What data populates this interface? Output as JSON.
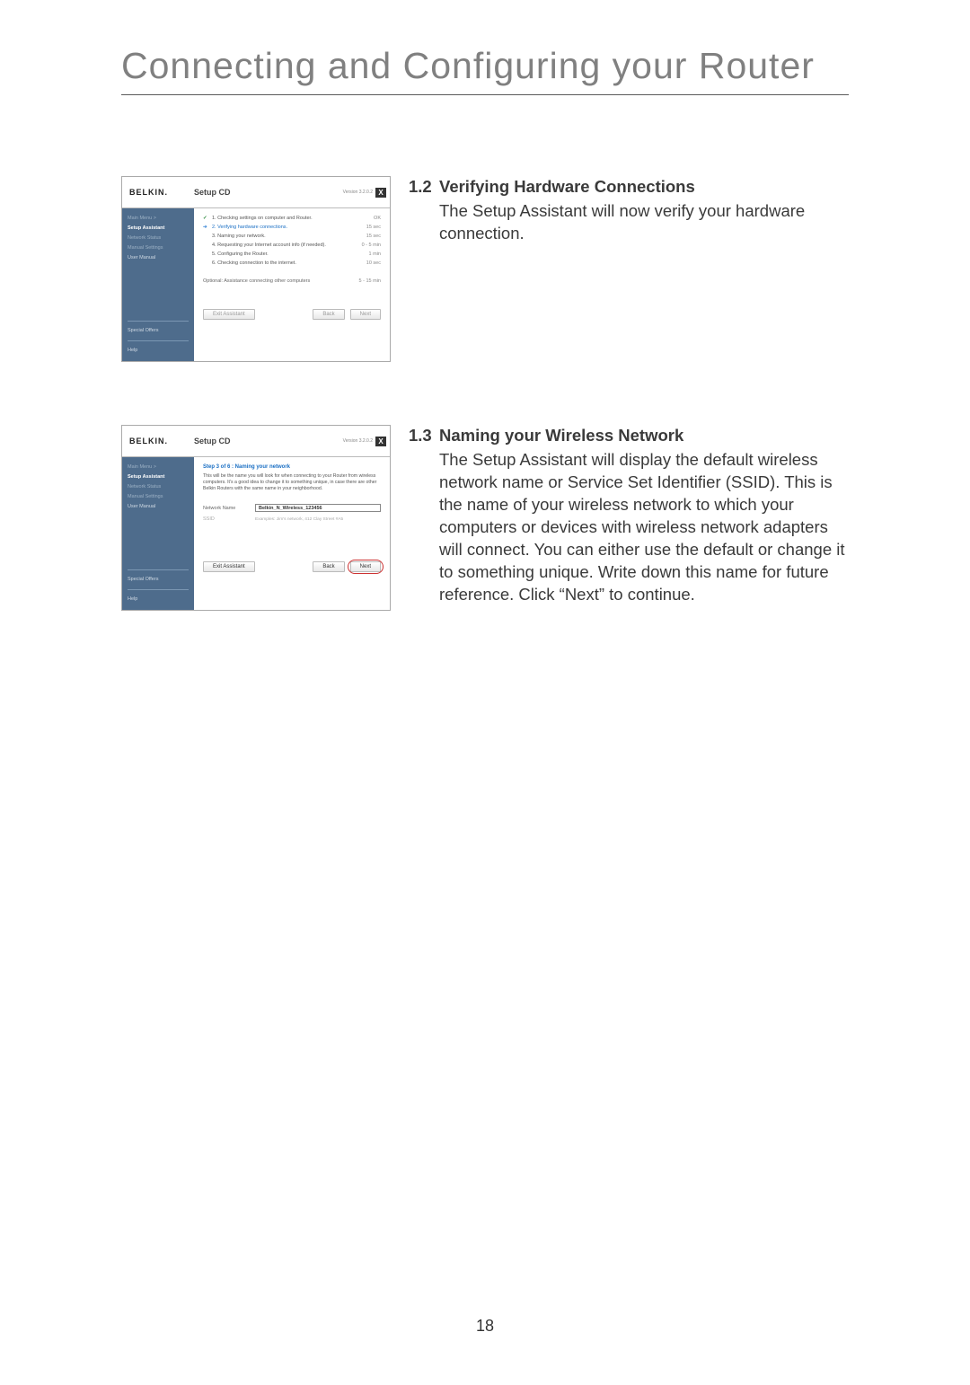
{
  "header": {
    "title": "Connecting and Configuring your Router"
  },
  "sections": [
    {
      "number": "1.2",
      "title": "Verifying Hardware Connections",
      "body": "The Setup Assistant will now verify your hardware connection."
    },
    {
      "number": "1.3",
      "title": "Naming your Wireless Network",
      "body": "The Setup Assistant will display the default wireless network name or Service Set Identifier (SSID). This is the name of your wireless network to which your computers or devices with wireless network adapters will connect. You can either use the default or change it to something unique. Write down this name for future reference. Click “Next” to continue."
    }
  ],
  "window_common": {
    "brand": "BELKIN.",
    "title": "Setup CD",
    "version": "Version 3.2.0.2",
    "nav": {
      "main_menu": "Main Menu >",
      "setup_assistant": "Setup Assistant",
      "network_status": "Network Status",
      "manual_settings": "Manual Settings",
      "user_manual": "User Manual",
      "special_offers": "Special Offers",
      "help": "Help"
    },
    "buttons": {
      "exit": "Exit Assistant",
      "back": "Back",
      "next": "Next"
    }
  },
  "window1": {
    "steps": [
      {
        "icon": "✓",
        "label": "1. Checking settings on computer and Router.",
        "dur": "OK",
        "highlight": false,
        "iconclass": "green"
      },
      {
        "icon": "➔",
        "label": "2. Verifying hardware connections.",
        "dur": "15 sec",
        "highlight": true,
        "iconclass": ""
      },
      {
        "icon": "",
        "label": "3. Naming your network.",
        "dur": "15 sec",
        "highlight": false,
        "iconclass": ""
      },
      {
        "icon": "",
        "label": "4. Requesting your Internet account info (if needed).",
        "dur": "0 - 5 min",
        "highlight": false,
        "iconclass": ""
      },
      {
        "icon": "",
        "label": "5. Configuring the Router.",
        "dur": "1 min",
        "highlight": false,
        "iconclass": ""
      },
      {
        "icon": "",
        "label": "6. Checking connection to the internet.",
        "dur": "10 sec",
        "highlight": false,
        "iconclass": ""
      }
    ],
    "optional_label": "Optional: Assistance connecting other computers",
    "optional_dur": "5 - 15 min"
  },
  "window2": {
    "step_header": "Step 3 of 6 : Naming your network",
    "step_desc": "This will be the name you will look for when connecting to your Router from wireless computers. It's a good idea to change it to something unique, in case there are other Belkin Routers with the same name in your neighborhood.",
    "network_name_label": "Network Name",
    "network_name_value": "Belkin_N_Wireless_123456",
    "ssid_label": "SSID",
    "ssid_hint": "Examples: Jim's network, 412 Clay Street #A5"
  },
  "page_number": "18"
}
